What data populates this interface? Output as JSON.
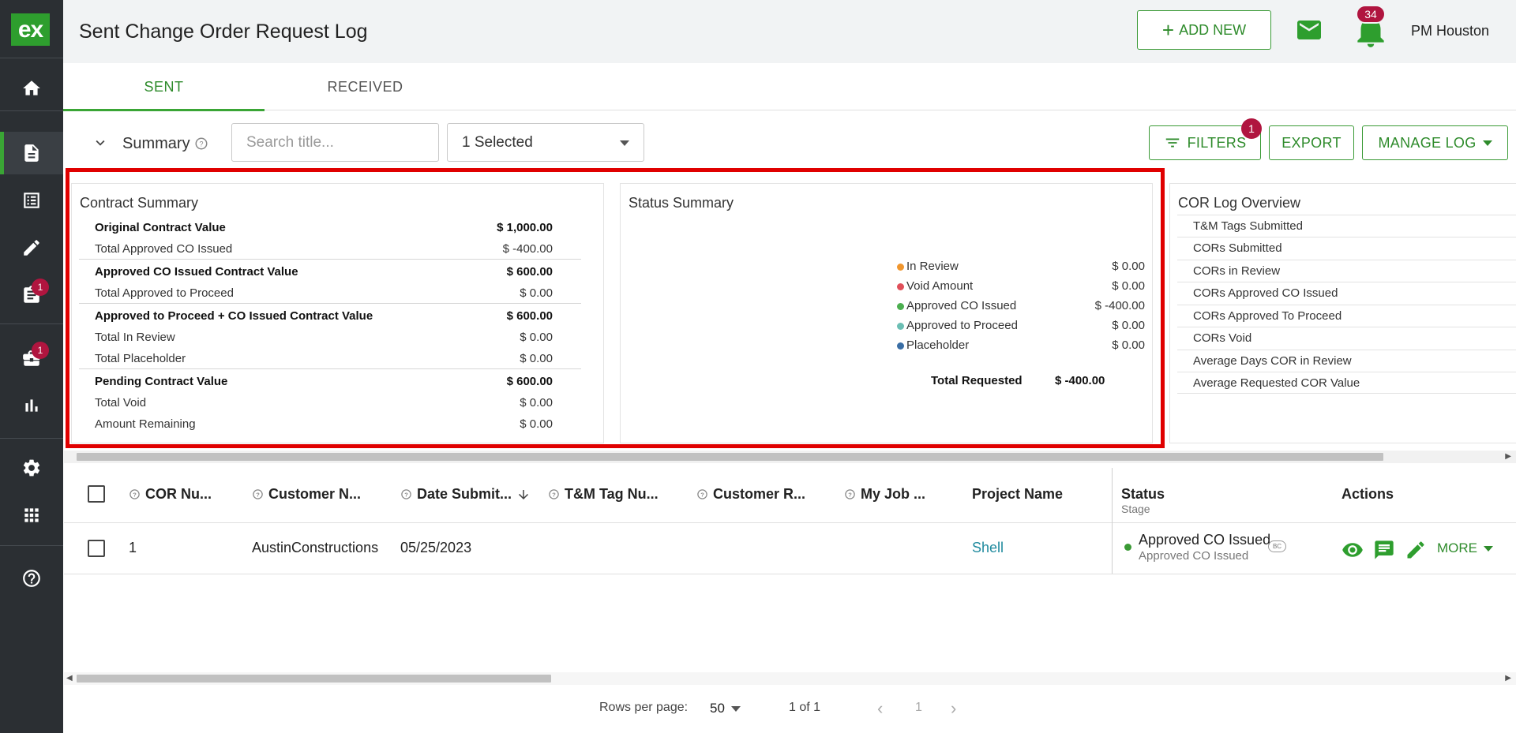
{
  "app": {
    "logo_text": "ex",
    "brand_color": "#2e9e2e",
    "accent_color": "#3aa535",
    "badge_color": "#b0153f"
  },
  "sidebar": {
    "items": [
      {
        "name": "home",
        "icon": "home-icon",
        "badge": ""
      },
      {
        "name": "documents",
        "icon": "document-icon",
        "badge": "",
        "active": true
      },
      {
        "name": "list",
        "icon": "list-icon",
        "badge": ""
      },
      {
        "name": "edit",
        "icon": "pencil-icon",
        "badge": ""
      },
      {
        "name": "clipboard",
        "icon": "clipboard-icon",
        "badge": "1"
      },
      {
        "name": "briefcase",
        "icon": "briefcase-icon",
        "badge": "1"
      },
      {
        "name": "reports",
        "icon": "bar-chart-icon",
        "badge": ""
      },
      {
        "name": "settings",
        "icon": "gear-icon",
        "badge": ""
      },
      {
        "name": "apps",
        "icon": "grid-icon",
        "badge": ""
      },
      {
        "name": "help",
        "icon": "help-icon",
        "badge": ""
      }
    ]
  },
  "header": {
    "title": "Sent Change Order Request Log",
    "add_new_label": "ADD NEW",
    "notifications_count": "34",
    "user_name": "PM Houston"
  },
  "tabs": [
    {
      "label": "SENT",
      "active": true
    },
    {
      "label": "RECEIVED",
      "active": false
    }
  ],
  "toolbar": {
    "summary_label": "Summary",
    "search_placeholder": "Search title...",
    "select_value": "1 Selected",
    "filters_label": "FILTERS",
    "filters_badge": "1",
    "export_label": "EXPORT",
    "manage_log_label": "MANAGE LOG"
  },
  "contract_summary": {
    "title": "Contract Summary",
    "rows": [
      {
        "label": "Original Contract Value",
        "value": "$ 1,000.00",
        "bold": true
      },
      {
        "label": "Total Approved CO Issued",
        "value": "$ -400.00",
        "bold": false
      },
      {
        "label": "Approved CO Issued Contract Value",
        "value": "$ 600.00",
        "bold": true
      },
      {
        "label": "Total Approved to Proceed",
        "value": "$ 0.00",
        "bold": false
      },
      {
        "label": "Approved to Proceed + CO Issued Contract Value",
        "value": "$ 600.00",
        "bold": true
      },
      {
        "label": "Total In Review",
        "value": "$ 0.00",
        "bold": false
      },
      {
        "label": "Total Placeholder",
        "value": "$ 0.00",
        "bold": false
      },
      {
        "label": "Pending Contract Value",
        "value": "$ 600.00",
        "bold": true
      },
      {
        "label": "Total Void",
        "value": "$ 0.00",
        "bold": false
      },
      {
        "label": "Amount Remaining",
        "value": "$ 0.00",
        "bold": false
      }
    ]
  },
  "status_summary": {
    "title": "Status Summary",
    "items": [
      {
        "label": "In Review",
        "value": "$ 0.00",
        "color": "#f0962e"
      },
      {
        "label": "Void Amount",
        "value": "$ 0.00",
        "color": "#e0505a"
      },
      {
        "label": "Approved CO Issued",
        "value": "$ -400.00",
        "color": "#4caf50"
      },
      {
        "label": "Approved to Proceed",
        "value": "$ 0.00",
        "color": "#6cbfb4"
      },
      {
        "label": "Placeholder",
        "value": "$ 0.00",
        "color": "#3a6ea5"
      }
    ],
    "total_label": "Total Requested",
    "total_value": "$ -400.00"
  },
  "cor_overview": {
    "title": "COR Log Overview",
    "items": [
      "T&M Tags Submitted",
      "CORs Submitted",
      "CORs in Review",
      "CORs Approved CO Issued",
      "CORs Approved To Proceed",
      "CORs Void",
      "Average Days COR in Review",
      "Average Requested COR Value"
    ]
  },
  "table": {
    "headers": {
      "cor_number": "COR Nu...",
      "customer_name": "Customer N...",
      "date_submitted": "Date Submit...",
      "tm_tag": "T&M Tag Nu...",
      "customer_ref": "Customer R...",
      "my_job": "My Job ...",
      "project_name": "Project Name",
      "status": "Status",
      "status_sub": "Stage",
      "actions": "Actions"
    },
    "rows": [
      {
        "cor_number": "1",
        "customer_name": "AustinConstructions",
        "date_submitted": "05/25/2023",
        "tm_tag": "",
        "customer_ref": "",
        "my_job": "",
        "project_name": "Shell",
        "status": "Approved CO Issued",
        "stage": "Approved CO Issued",
        "tag": "BC",
        "more_label": "MORE"
      }
    ]
  },
  "pagination": {
    "rows_per_page_label": "Rows per page:",
    "rows_per_page": "50",
    "range": "1 of 1",
    "current_page": "1"
  }
}
